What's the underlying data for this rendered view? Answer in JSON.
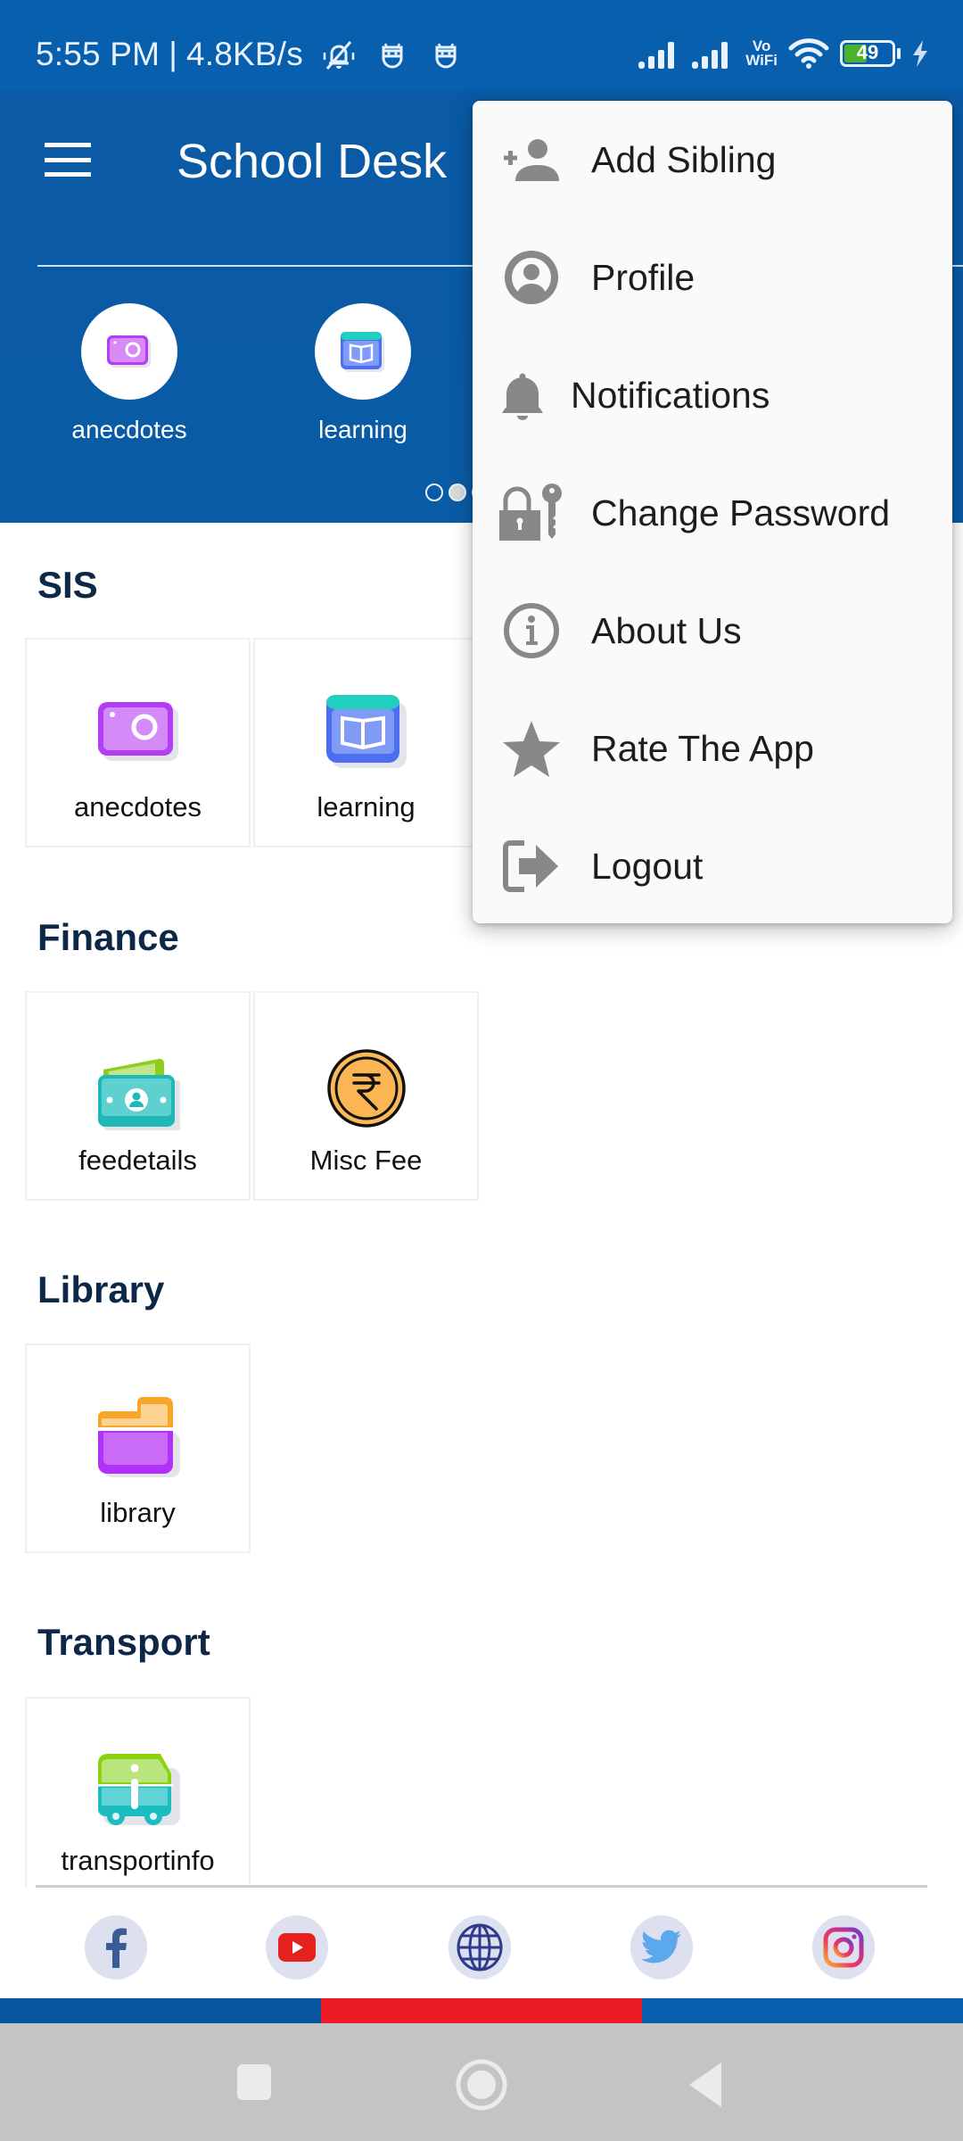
{
  "status_bar": {
    "time": "5:55 PM",
    "separator": "|",
    "network_speed": "4.8KB/s",
    "battery_percent": 49,
    "battery_label": "49",
    "vowifi_top": "Vo",
    "vowifi_bottom": "WiFi",
    "icons": [
      "mute-bell-icon",
      "app-notification-icon",
      "app-notification-icon",
      "signal-icon",
      "signal-icon",
      "vowifi-icon",
      "wifi-icon",
      "battery-icon",
      "charging-icon"
    ]
  },
  "header": {
    "title": "School Desk",
    "menu_icon": "hamburger-icon",
    "quick_access": [
      {
        "label": "anecdotes",
        "icon": "camera-icon"
      },
      {
        "label": "learning",
        "icon": "book-icon"
      }
    ],
    "carousel": {
      "pages": 3,
      "active_page": 1
    }
  },
  "sections": [
    {
      "title": "SIS",
      "tiles": [
        {
          "label": "anecdotes",
          "icon": "camera-icon"
        },
        {
          "label": "learning",
          "icon": "book-icon"
        }
      ]
    },
    {
      "title": "Finance",
      "tiles": [
        {
          "label": "feedetails",
          "icon": "money-icon"
        },
        {
          "label": "Misc Fee",
          "icon": "rupee-coin-icon"
        }
      ]
    },
    {
      "title": "Library",
      "tiles": [
        {
          "label": "library",
          "icon": "folder-icon"
        }
      ]
    },
    {
      "title": "Transport",
      "tiles": [
        {
          "label": "transportinfo",
          "icon": "bus-info-icon"
        }
      ]
    }
  ],
  "social_links": [
    {
      "name": "facebook",
      "icon": "facebook-icon"
    },
    {
      "name": "youtube",
      "icon": "youtube-icon"
    },
    {
      "name": "website",
      "icon": "globe-icon"
    },
    {
      "name": "twitter",
      "icon": "twitter-icon"
    },
    {
      "name": "instagram",
      "icon": "instagram-icon"
    }
  ],
  "color_bar": [
    "#07559c",
    "#ec1c24",
    "#075fae"
  ],
  "overflow_menu": {
    "items": [
      {
        "label": "Add Sibling",
        "icon": "add-person-icon"
      },
      {
        "label": "Profile",
        "icon": "profile-icon"
      },
      {
        "label": "Notifications",
        "icon": "bell-icon"
      },
      {
        "label": "Change Password",
        "icon": "lock-key-icon"
      },
      {
        "label": "About Us",
        "icon": "info-icon"
      },
      {
        "label": "Rate The App",
        "icon": "star-icon"
      },
      {
        "label": "Logout",
        "icon": "logout-icon"
      }
    ]
  },
  "nav_bar": {
    "buttons": [
      "recents-button",
      "home-button",
      "back-button"
    ]
  },
  "colors": {
    "primary": "#075fae",
    "section_title": "#0d2747",
    "menu_icon_gray": "#888888",
    "accent_red": "#ec1c24"
  }
}
